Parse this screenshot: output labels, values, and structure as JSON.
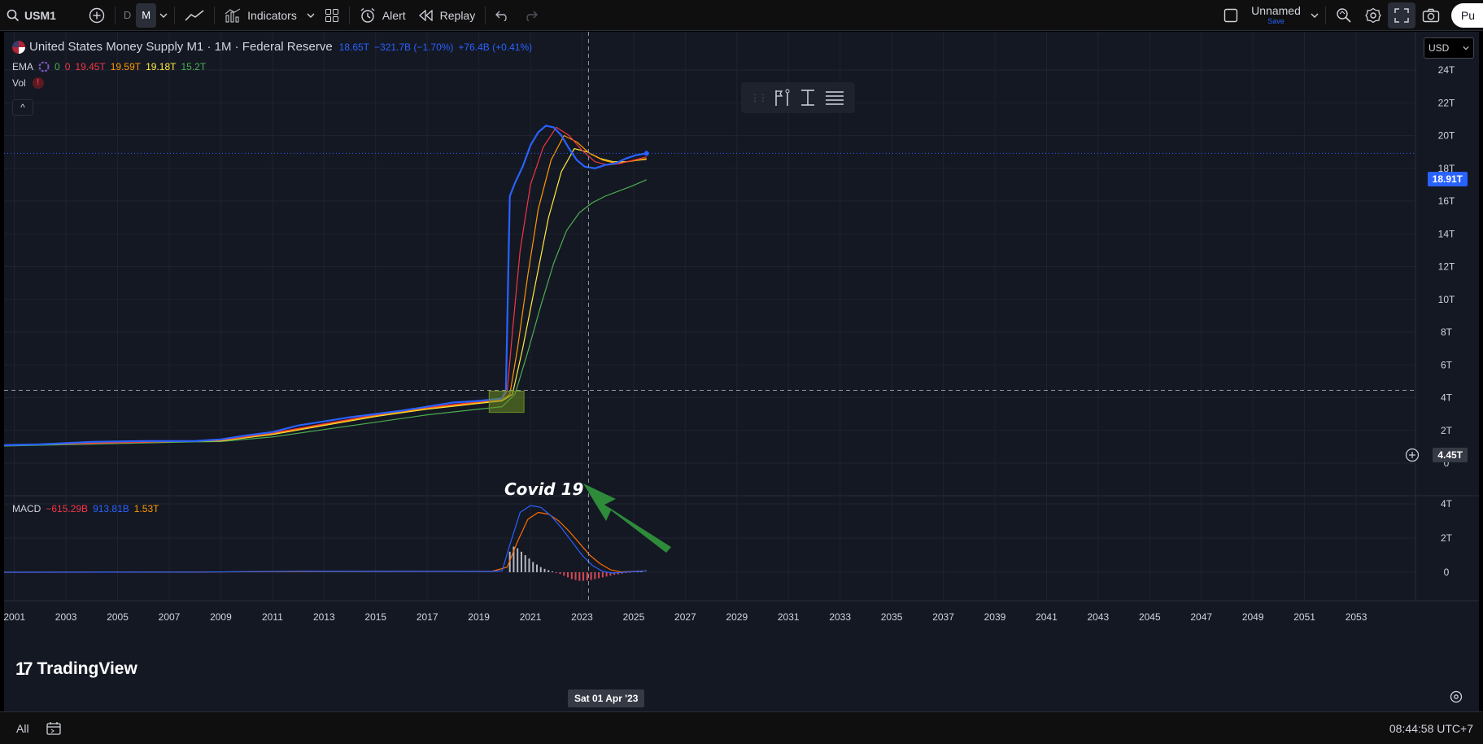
{
  "toolbar": {
    "symbol": "USM1",
    "intervals": [
      "D",
      "M"
    ],
    "active_interval": "M",
    "indicators_label": "Indicators",
    "alert_label": "Alert",
    "replay_label": "Replay",
    "layout_name": "Unnamed",
    "save_label": "Save",
    "publish_label": "Pu"
  },
  "legend": {
    "title": "United States Money Supply M1 · 1M · Federal Reserve",
    "last": "18.65T",
    "change_a": "−321.7B (−1.70%)",
    "change_b": "+76.4B (+0.41%)",
    "ema_label": "EMA",
    "ema_values": [
      "0",
      "0",
      "19.45T",
      "19.59T",
      "19.18T",
      "15.2T"
    ],
    "vol_label": "Vol",
    "vol_warning": "!",
    "collapse_symbol": "^",
    "macd_label": "MACD",
    "macd_values": [
      "−615.29B",
      "913.81B",
      "1.53T"
    ]
  },
  "currency": "USD",
  "price_tag": "18.91T",
  "crosshair_price": "4.45T",
  "crosshair_time": "Sat 01 Apr '23",
  "annotation": "Covid 19",
  "logo_text": "TradingView",
  "bottom": {
    "range_all": "All",
    "clock": "08:44:58 UTC+7"
  },
  "colors": {
    "price": "#2962ff",
    "ema_1": "#f23645",
    "ema_2": "#ff9800",
    "ema_3": "#ffeb3b",
    "ema_4": "#4caf50",
    "macd_line": "#2962ff",
    "signal_line": "#ff6d00",
    "covid_box": "#6b8e23",
    "arrow": "#2e8b3a"
  },
  "chart_data": {
    "type": "line",
    "x_ticks": [
      "2001",
      "2003",
      "2005",
      "2007",
      "2009",
      "2011",
      "2013",
      "2015",
      "2017",
      "2019",
      "2021",
      "2023",
      "2025",
      "2027",
      "2029",
      "2031",
      "2033",
      "2035",
      "2037",
      "2039",
      "2041",
      "2043",
      "2045",
      "2047",
      "2049",
      "2051",
      "2053"
    ],
    "x_range": [
      2000.6,
      2055.3
    ],
    "y_ticks": [
      "0",
      "2T",
      "4T",
      "6T",
      "8T",
      "10T",
      "12T",
      "14T",
      "16T",
      "18T",
      "20T",
      "22T",
      "24T"
    ],
    "y_range": [
      0,
      24
    ],
    "macd_y_ticks": [
      "0",
      "2T",
      "4T"
    ],
    "macd_y_range": [
      -0.5,
      4
    ],
    "series": [
      {
        "key": "price",
        "x": [
          2000.6,
          2002,
          2004,
          2006,
          2008,
          2009,
          2010,
          2011,
          2012,
          2013,
          2014,
          2015,
          2016,
          2017,
          2018,
          2019,
          2019.9,
          2020.05,
          2020.2,
          2020.4,
          2020.7,
          2021,
          2021.3,
          2021.6,
          2021.9,
          2022.2,
          2022.5,
          2022.8,
          2023.1,
          2023.5,
          2023.9,
          2024.3,
          2024.7,
          2025.1,
          2025.5
        ],
        "y": [
          1.1,
          1.15,
          1.3,
          1.35,
          1.35,
          1.45,
          1.7,
          1.9,
          2.3,
          2.55,
          2.8,
          3.0,
          3.2,
          3.45,
          3.7,
          3.8,
          3.95,
          4.5,
          16.3,
          17.1,
          18.1,
          19.4,
          20.2,
          20.6,
          20.5,
          20.0,
          19.2,
          18.5,
          18.1,
          18.0,
          18.2,
          18.3,
          18.6,
          18.8,
          18.91
        ]
      },
      {
        "key": "ema_1",
        "x": [
          2000.6,
          2008,
          2009,
          2011,
          2013,
          2015,
          2017,
          2019,
          2019.9,
          2020.1,
          2020.3,
          2020.6,
          2021,
          2021.5,
          2022,
          2022.5,
          2023,
          2023.5,
          2024,
          2024.5,
          2025.5
        ],
        "y": [
          1.1,
          1.35,
          1.4,
          1.85,
          2.4,
          2.95,
          3.4,
          3.75,
          3.9,
          4.4,
          8,
          13,
          17,
          19.3,
          20.5,
          20,
          19.1,
          18.4,
          18.2,
          18.3,
          18.7
        ]
      },
      {
        "key": "ema_2",
        "x": [
          2000.6,
          2008,
          2009,
          2011,
          2013,
          2015,
          2017,
          2019,
          2019.9,
          2020.2,
          2020.5,
          2020.9,
          2021.3,
          2021.8,
          2022.3,
          2022.8,
          2023.3,
          2023.8,
          2024.3,
          2024.8,
          2025.5
        ],
        "y": [
          1.1,
          1.35,
          1.38,
          1.8,
          2.35,
          2.9,
          3.35,
          3.7,
          3.85,
          4.2,
          7,
          11.5,
          15.5,
          18.5,
          20,
          19.6,
          18.9,
          18.5,
          18.3,
          18.4,
          18.6
        ]
      },
      {
        "key": "ema_3",
        "x": [
          2000.6,
          2008,
          2009,
          2011,
          2013,
          2015,
          2017,
          2019,
          2019.9,
          2020.3,
          2020.7,
          2021.2,
          2021.7,
          2022.2,
          2022.7,
          2023.2,
          2023.7,
          2024.2,
          2024.7,
          2025.5
        ],
        "y": [
          1.1,
          1.35,
          1.36,
          1.75,
          2.3,
          2.85,
          3.3,
          3.65,
          3.8,
          4.2,
          7,
          11,
          15,
          17.8,
          19.2,
          19.0,
          18.6,
          18.4,
          18.4,
          18.55
        ]
      },
      {
        "key": "ema_4",
        "x": [
          2000.6,
          2008,
          2009,
          2011,
          2013,
          2015,
          2017,
          2019,
          2019.9,
          2020.4,
          2020.9,
          2021.4,
          2021.9,
          2022.4,
          2022.9,
          2023.4,
          2023.9,
          2024.4,
          2024.9,
          2025.5
        ],
        "y": [
          1.05,
          1.3,
          1.32,
          1.6,
          2.05,
          2.5,
          2.95,
          3.3,
          3.45,
          4.2,
          6.8,
          9.6,
          12.2,
          14.2,
          15.3,
          15.9,
          16.3,
          16.6,
          16.9,
          17.3
        ]
      },
      {
        "key": "macd_line",
        "x": [
          2000.6,
          2008,
          2012,
          2019.5,
          2019.9,
          2020.2,
          2020.6,
          2021,
          2021.4,
          2021.8,
          2022.2,
          2022.6,
          2023,
          2023.4,
          2023.8,
          2024.2,
          2024.6,
          2025.5
        ],
        "y": [
          0,
          0.01,
          0.06,
          0.05,
          0.08,
          1.6,
          3.5,
          3.9,
          3.8,
          3.3,
          2.6,
          1.8,
          1.0,
          0.4,
          0.05,
          -0.05,
          0,
          0.08
        ]
      },
      {
        "key": "signal_line",
        "x": [
          2000.6,
          2008,
          2012,
          2019.5,
          2020.1,
          2020.5,
          2020.9,
          2021.3,
          2021.7,
          2022.1,
          2022.5,
          2022.9,
          2023.3,
          2023.7,
          2024.1,
          2024.5,
          2025.5
        ],
        "y": [
          0,
          0.01,
          0.05,
          0.05,
          0.3,
          1.8,
          3.1,
          3.5,
          3.4,
          3.0,
          2.4,
          1.7,
          1.0,
          0.5,
          0.15,
          0.02,
          0.08
        ]
      }
    ],
    "histogram": {
      "x": [
        2020.2,
        2020.35,
        2020.5,
        2020.65,
        2020.8,
        2020.95,
        2021.1,
        2021.25,
        2021.4,
        2021.55,
        2021.7,
        2021.85,
        2022.0,
        2022.15,
        2022.3,
        2022.45,
        2022.6,
        2022.75,
        2022.9,
        2023.05,
        2023.2,
        2023.35,
        2023.5,
        2023.65,
        2023.8,
        2023.95,
        2024.1,
        2024.25,
        2024.4,
        2024.55,
        2024.7,
        2024.85,
        2025.0,
        2025.15,
        2025.3
      ],
      "values": [
        1.2,
        1.5,
        1.4,
        1.2,
        1.0,
        0.8,
        0.6,
        0.45,
        0.3,
        0.2,
        0.12,
        0.05,
        -0.05,
        -0.1,
        -0.2,
        -0.3,
        -0.4,
        -0.45,
        -0.5,
        -0.5,
        -0.48,
        -0.45,
        -0.4,
        -0.35,
        -0.3,
        -0.25,
        -0.2,
        -0.15,
        -0.12,
        -0.08,
        -0.05,
        -0.03,
        0.02,
        0.03,
        0.04
      ]
    },
    "crosshair": {
      "x": 2023.25,
      "y": 4.45
    },
    "covid_box": {
      "x": [
        2019.4,
        2020.75
      ],
      "y": [
        3.1,
        4.4
      ]
    },
    "grid": true,
    "legend_position": "top-left"
  }
}
